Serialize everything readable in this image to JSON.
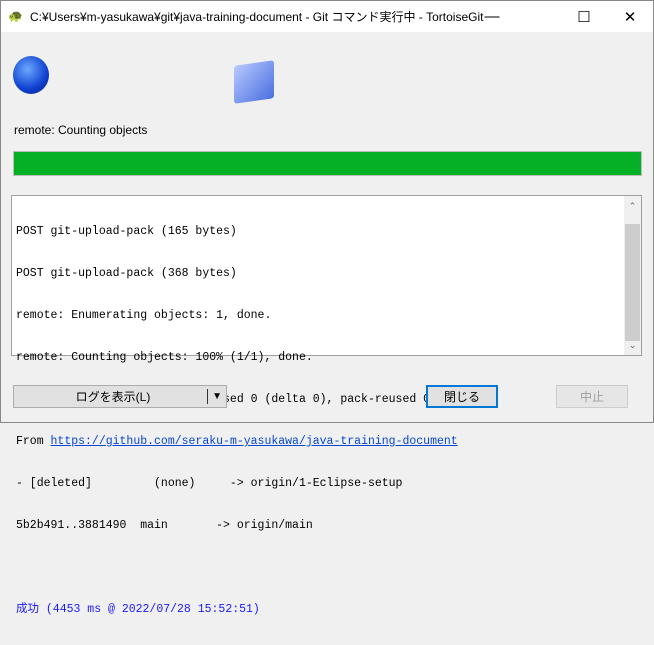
{
  "window": {
    "title": "C:¥Users¥m-yasukawa¥git¥java-training-document - Git コマンド実行中 - TortoiseGit"
  },
  "status": "remote: Counting objects",
  "progress_percent": 100,
  "log": {
    "lines": [
      "POST git-upload-pack (165 bytes)",
      "POST git-upload-pack (368 bytes)",
      "remote: Enumerating objects: 1, done.",
      "remote: Counting objects: 100% (1/1), done.",
      "remote: Total 1 (delta 0), reused 0 (delta 0), pack-reused 0"
    ],
    "from_label": "From ",
    "url": "https://github.com/seraku-m-yasukawa/java-training-document",
    "lines2": [
      "- [deleted]         (none)     -> origin/1-Eclipse-setup",
      "5b2b491..3881490  main       -> origin/main"
    ],
    "result": "成功 (4453 ms @ 2022/07/28 15:52:51)"
  },
  "buttons": {
    "show_log": "ログを表示(L)",
    "close": "閉じる",
    "abort": "中止"
  }
}
